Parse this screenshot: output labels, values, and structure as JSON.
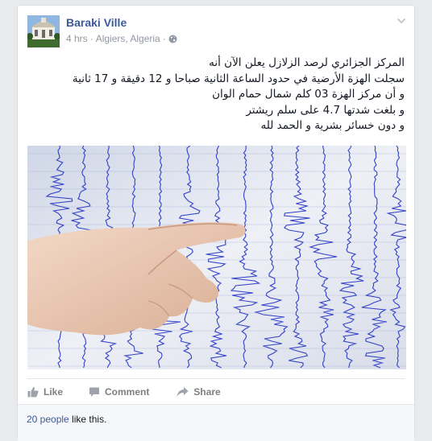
{
  "post": {
    "page_name": "Baraki Ville",
    "time": "4 hrs",
    "separator": "·",
    "location": "Algiers, Algeria",
    "privacy_icon": "globe-icon",
    "menu_icon": "chevron-down-icon",
    "text_lines": [
      "المركز الجزائري لرصد الزلازل يعلن الآن أنه",
      "سجلت الهزة الأرضية في حدود الساعة الثانية صباحا و 12 دقيقة و 17 ثانية",
      "و أن مركز الهزة 03 كلم شمال حمام الوان",
      "و بلغت شدتها 4.7 على سلم ريشتر",
      "و دون خسائر بشرية و الحمد لله"
    ]
  },
  "actions": {
    "like": "Like",
    "comment": "Comment",
    "share": "Share"
  },
  "likes": {
    "count_text": "20 people",
    "suffix": " like this."
  },
  "colors": {
    "link_blue": "#3b5998",
    "seismograph_blue": "#1f2fc4",
    "meta_gray": "#9197a3"
  }
}
